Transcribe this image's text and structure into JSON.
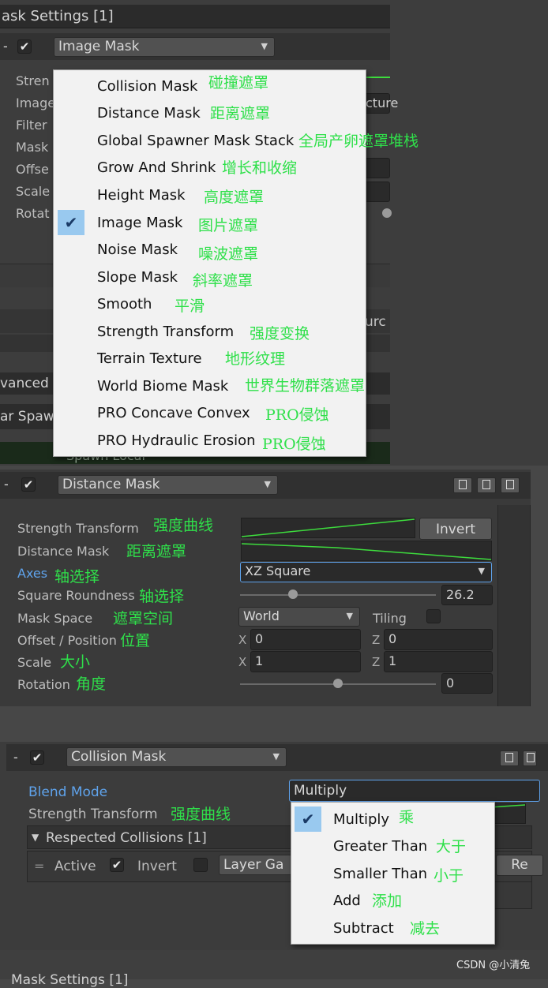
{
  "top_section": {
    "title": "ask Settings [1]",
    "mask_dash": "-",
    "mask_type": "Image Mask",
    "left_labels": [
      "Stren",
      "Image",
      "Filter",
      "Mask",
      "Offse",
      "Scale",
      "Rotat"
    ],
    "right_cut": "cture",
    "right_cut_2": "urc",
    "advanced_label": "vanced",
    "spawn_label": "ar Spaw",
    "spawn_local": "Spawn Local"
  },
  "mask_menu": {
    "items": [
      {
        "label": "Collision Mask",
        "note": "碰撞遮罩",
        "checked": false
      },
      {
        "label": "Distance Mask",
        "note": "距离遮罩",
        "checked": false
      },
      {
        "label": "Global Spawner Mask Stack",
        "note": "全局产卵遮罩堆栈",
        "checked": false
      },
      {
        "label": "Grow And Shrink",
        "note": "增长和收缩",
        "checked": false
      },
      {
        "label": "Height Mask",
        "note": "高度遮罩",
        "checked": false
      },
      {
        "label": "Image Mask",
        "note": "图片遮罩",
        "checked": true
      },
      {
        "label": "Noise Mask",
        "note": "噪波遮罩",
        "checked": false
      },
      {
        "label": "Slope Mask",
        "note": "斜率遮罩",
        "checked": false
      },
      {
        "label": "Smooth",
        "note": "平滑",
        "checked": false
      },
      {
        "label": "Strength Transform",
        "note": "强度变换",
        "checked": false
      },
      {
        "label": "Terrain Texture",
        "note": "地形纹理",
        "checked": false
      },
      {
        "label": "World Biome Mask",
        "note": "世界生物群落遮罩",
        "checked": false
      },
      {
        "label": "PRO Concave Convex",
        "note": "PRO侵蚀",
        "checked": false
      },
      {
        "label": "PRO Hydraulic Erosion",
        "note": "PRO侵蚀",
        "checked": false
      }
    ]
  },
  "distance_section": {
    "dash": "-",
    "mask_type": "Distance Mask",
    "strength_label": "Strength Transform",
    "strength_note": "强度曲线",
    "invert_button": "Invert",
    "distance_label": "Distance Mask",
    "distance_note": "距离遮罩",
    "axes_label": "Axes",
    "axes_note": "轴选择",
    "axes_value": "XZ Square",
    "roundness_label": "Square Roundness",
    "roundness_note": "轴选择",
    "roundness_value": "26.2",
    "roundness_level": 0.27,
    "space_label": "Mask Space",
    "space_note": "遮罩空间",
    "space_value": "World",
    "tiling_label": "Tiling",
    "offset_label": "Offset / Position",
    "offset_note": "位置",
    "offset_x_axis": "X",
    "offset_x": "0",
    "offset_z_axis": "Z",
    "offset_z": "0",
    "scale_label": "Scale",
    "scale_note": "大小",
    "scale_x_axis": "X",
    "scale_x": "1",
    "scale_z_axis": "Z",
    "scale_z": "1",
    "rotation_label": "Rotation",
    "rotation_note": "角度",
    "rotation_value": "0",
    "rotation_level": 0.5
  },
  "collision_section": {
    "dash": "-",
    "mask_type": "Collision Mask",
    "blend_label": "Blend Mode",
    "blend_value": "Multiply",
    "strength_label": "Strength Transform",
    "strength_note": "强度曲线",
    "respected_label": "Respected Collisions [1]",
    "active_label": "Active",
    "invert_label": "Invert",
    "layer_label": "Layer Ga",
    "right_cut": "Re"
  },
  "blend_menu": {
    "items": [
      {
        "label": "Multiply",
        "note": "乘",
        "checked": true
      },
      {
        "label": "Greater Than",
        "note": "大于",
        "checked": false
      },
      {
        "label": "Smaller Than",
        "note": "小于",
        "checked": false
      },
      {
        "label": "Add",
        "note": "添加",
        "checked": false
      },
      {
        "label": "Subtract",
        "note": "减去",
        "checked": false
      }
    ]
  },
  "bottom": {
    "cut_title": "Mask Settings [1]",
    "watermark": "CSDN @小清兔"
  },
  "colors": {
    "accent_blue": "#5fa3ec",
    "note_green": "#2fe04a",
    "curve_green": "#3ddc3d",
    "menu_check_bg": "#99c9ef"
  }
}
